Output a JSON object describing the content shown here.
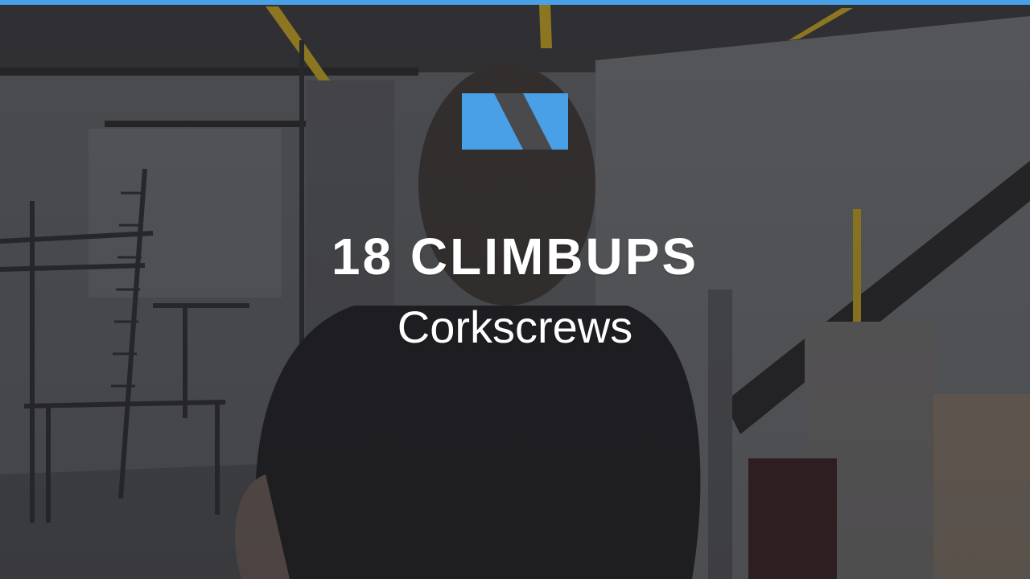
{
  "overlay": {
    "title": "18 CLIMBUPS",
    "subtitle": "Corkscrews"
  },
  "logo": {
    "icon": "brand-logo-icon",
    "color": "#4aa0e6"
  },
  "accent_bar_color": "#4aa0e6",
  "background": {
    "description_icon": "gym-scene-photo",
    "palette": [
      "#4a4a4c",
      "#6b6d70",
      "#2c2c30",
      "#c9a227"
    ]
  }
}
